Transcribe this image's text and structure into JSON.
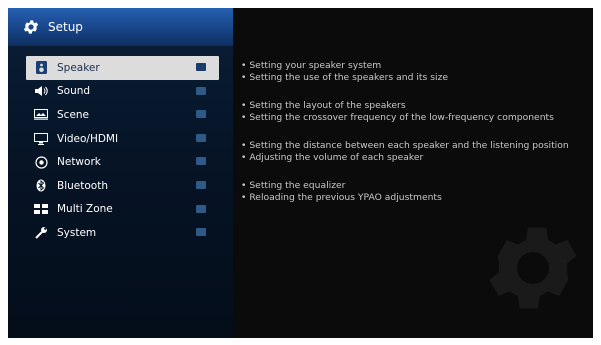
{
  "header": {
    "title": "Setup",
    "icon": "gear-icon"
  },
  "menu": {
    "items": [
      {
        "label": "Speaker",
        "icon": "speaker-icon",
        "selected": true
      },
      {
        "label": "Sound",
        "icon": "sound-icon",
        "selected": false
      },
      {
        "label": "Scene",
        "icon": "scene-icon",
        "selected": false
      },
      {
        "label": "Video/HDMI",
        "icon": "video-hdmi-icon",
        "selected": false
      },
      {
        "label": "Network",
        "icon": "network-icon",
        "selected": false
      },
      {
        "label": "Bluetooth",
        "icon": "bluetooth-icon",
        "selected": false
      },
      {
        "label": "Multi Zone",
        "icon": "multi-zone-icon",
        "selected": false
      },
      {
        "label": "System",
        "icon": "wrench-icon",
        "selected": false
      }
    ]
  },
  "description": {
    "groups": [
      {
        "lines": [
          "• Setting your speaker system",
          "• Setting the use of the speakers and its size"
        ]
      },
      {
        "lines": [
          "• Setting the layout of the speakers",
          "• Setting the crossover frequency of the low-frequency components"
        ]
      },
      {
        "lines": [
          "• Setting the distance between each speaker and the listening position",
          "• Adjusting the volume of each speaker"
        ]
      },
      {
        "lines": [
          "• Setting the equalizer",
          "• Reloading the previous YPAO adjustments"
        ]
      }
    ]
  },
  "colors": {
    "header_blue": "#1a4a90",
    "sidebar_bg": "#061426",
    "selected_bg": "#dcdcdc",
    "description_text": "#c8c8c8"
  }
}
